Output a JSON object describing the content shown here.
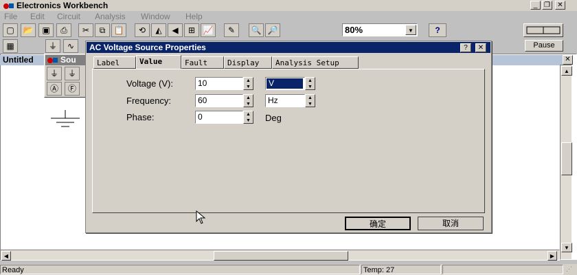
{
  "app": {
    "title": "Electronics Workbench"
  },
  "menu": [
    "File",
    "Edit",
    "Circuit",
    "Analysis",
    "Window",
    "Help"
  ],
  "toolbar": {
    "zoom": "80%",
    "help": "?",
    "pause_label": "Pause"
  },
  "document": {
    "title": "Untitled",
    "parts_bin_title": "Sou"
  },
  "dialog": {
    "title": "AC Voltage Source Properties",
    "help_btn": "?",
    "close_btn": "✕",
    "tabs": [
      "Label",
      "Value",
      "Fault",
      "Display",
      "Analysis Setup"
    ],
    "active_tab": "Value",
    "fields": [
      {
        "label": "Voltage (V):",
        "value": "10",
        "unit": "V"
      },
      {
        "label": "Frequency:",
        "value": "60",
        "unit": "Hz"
      },
      {
        "label": "Phase:",
        "value": "0",
        "unit": "Deg"
      }
    ],
    "ok_label": "确定",
    "cancel_label": "取消"
  },
  "status": {
    "left": "Ready",
    "temp": "Temp: 27"
  }
}
